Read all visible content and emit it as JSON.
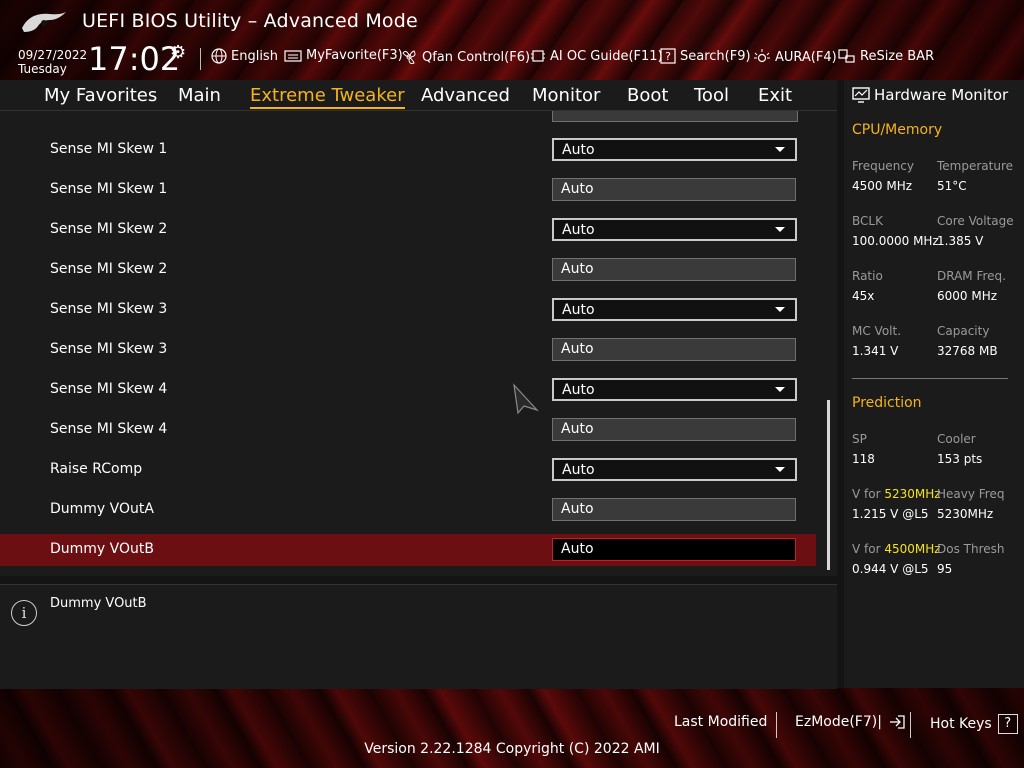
{
  "app": {
    "title": "UEFI BIOS Utility – Advanced Mode"
  },
  "status": {
    "date": "09/27/2022",
    "weekday": "Tuesday",
    "time": "17:02"
  },
  "toolbar": {
    "language": "English",
    "myfavorite": "MyFavorite(F3)",
    "qfan": "Qfan Control(F6)",
    "aioc": "AI OC Guide(F11)",
    "search": "Search(F9)",
    "aura": "AURA(F4)",
    "resizebar": "ReSize BAR"
  },
  "tabs": [
    "My Favorites",
    "Main",
    "Extreme Tweaker",
    "Advanced",
    "Monitor",
    "Boot",
    "Tool",
    "Exit"
  ],
  "active_tab": "Extreme Tweaker",
  "settings": [
    {
      "label": "Sense MI Skew 1",
      "value": "Auto",
      "kind": "dropdown"
    },
    {
      "label": "Sense MI Skew 1",
      "value": "Auto",
      "kind": "readonly"
    },
    {
      "label": "Sense MI Skew 2",
      "value": "Auto",
      "kind": "dropdown"
    },
    {
      "label": "Sense MI Skew 2",
      "value": "Auto",
      "kind": "readonly"
    },
    {
      "label": "Sense MI Skew 3",
      "value": "Auto",
      "kind": "dropdown"
    },
    {
      "label": "Sense MI Skew 3",
      "value": "Auto",
      "kind": "readonly"
    },
    {
      "label": "Sense MI Skew 4",
      "value": "Auto",
      "kind": "dropdown"
    },
    {
      "label": "Sense MI Skew 4",
      "value": "Auto",
      "kind": "readonly"
    },
    {
      "label": "Raise RComp",
      "value": "Auto",
      "kind": "dropdown"
    },
    {
      "label": "Dummy VOutA",
      "value": "Auto",
      "kind": "readonly"
    },
    {
      "label": "Dummy VOutB",
      "value": "Auto",
      "kind": "editing",
      "selected": true
    }
  ],
  "help": {
    "text": "Dummy VOutB"
  },
  "hw": {
    "title": "Hardware Monitor",
    "cpu_section": "CPU/Memory",
    "frequency_label": "Frequency",
    "frequency": "4500 MHz",
    "temperature_label": "Temperature",
    "temperature": "51°C",
    "bclk_label": "BCLK",
    "bclk": "100.0000 MHz",
    "core_voltage_label": "Core Voltage",
    "core_voltage": "1.385 V",
    "ratio_label": "Ratio",
    "ratio": "45x",
    "dram_label": "DRAM Freq.",
    "dram": "6000 MHz",
    "mc_label": "MC Volt.",
    "mc": "1.341 V",
    "capacity_label": "Capacity",
    "capacity": "32768 MB",
    "prediction_section": "Prediction",
    "sp_label": "SP",
    "sp": "118",
    "cooler_label": "Cooler",
    "cooler": "153 pts",
    "vfor_prefix": "V for ",
    "vfor1_freq": "5230MHz",
    "vfor1": "1.215 V @L5",
    "heavy_label": "Heavy Freq",
    "heavy": "5230MHz",
    "vfor2_freq": "4500MHz",
    "vfor2": "0.944 V @L5",
    "dos_label": "Dos Thresh",
    "dos": "95"
  },
  "footer": {
    "last_modified": "Last Modified",
    "ezmode": "EzMode(F7)|",
    "hotkeys": "Hot Keys",
    "hotkeys_key": "?",
    "version": "Version 2.22.1284 Copyright (C) 2022 AMI"
  },
  "colors": {
    "accent": "#f4b41a",
    "selected_row": "#6b0f12",
    "highlight": "#f4e21a"
  }
}
